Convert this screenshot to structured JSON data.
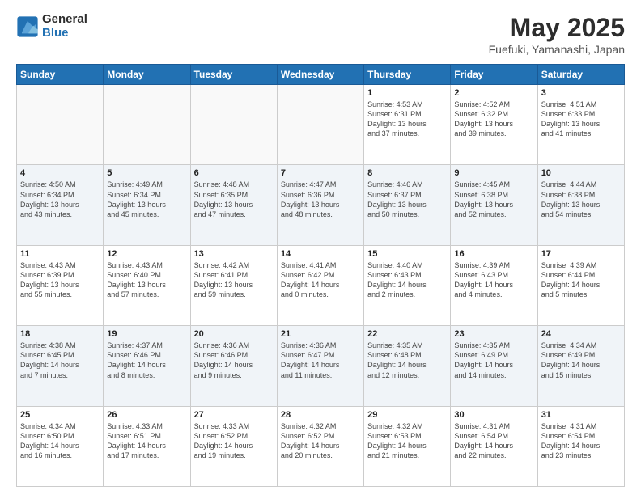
{
  "logo": {
    "line1": "General",
    "line2": "Blue"
  },
  "title": "May 2025",
  "subtitle": "Fuefuki, Yamanashi, Japan",
  "weekdays": [
    "Sunday",
    "Monday",
    "Tuesday",
    "Wednesday",
    "Thursday",
    "Friday",
    "Saturday"
  ],
  "weeks": [
    [
      {
        "day": "",
        "detail": ""
      },
      {
        "day": "",
        "detail": ""
      },
      {
        "day": "",
        "detail": ""
      },
      {
        "day": "",
        "detail": ""
      },
      {
        "day": "1",
        "detail": "Sunrise: 4:53 AM\nSunset: 6:31 PM\nDaylight: 13 hours\nand 37 minutes."
      },
      {
        "day": "2",
        "detail": "Sunrise: 4:52 AM\nSunset: 6:32 PM\nDaylight: 13 hours\nand 39 minutes."
      },
      {
        "day": "3",
        "detail": "Sunrise: 4:51 AM\nSunset: 6:33 PM\nDaylight: 13 hours\nand 41 minutes."
      }
    ],
    [
      {
        "day": "4",
        "detail": "Sunrise: 4:50 AM\nSunset: 6:34 PM\nDaylight: 13 hours\nand 43 minutes."
      },
      {
        "day": "5",
        "detail": "Sunrise: 4:49 AM\nSunset: 6:34 PM\nDaylight: 13 hours\nand 45 minutes."
      },
      {
        "day": "6",
        "detail": "Sunrise: 4:48 AM\nSunset: 6:35 PM\nDaylight: 13 hours\nand 47 minutes."
      },
      {
        "day": "7",
        "detail": "Sunrise: 4:47 AM\nSunset: 6:36 PM\nDaylight: 13 hours\nand 48 minutes."
      },
      {
        "day": "8",
        "detail": "Sunrise: 4:46 AM\nSunset: 6:37 PM\nDaylight: 13 hours\nand 50 minutes."
      },
      {
        "day": "9",
        "detail": "Sunrise: 4:45 AM\nSunset: 6:38 PM\nDaylight: 13 hours\nand 52 minutes."
      },
      {
        "day": "10",
        "detail": "Sunrise: 4:44 AM\nSunset: 6:38 PM\nDaylight: 13 hours\nand 54 minutes."
      }
    ],
    [
      {
        "day": "11",
        "detail": "Sunrise: 4:43 AM\nSunset: 6:39 PM\nDaylight: 13 hours\nand 55 minutes."
      },
      {
        "day": "12",
        "detail": "Sunrise: 4:43 AM\nSunset: 6:40 PM\nDaylight: 13 hours\nand 57 minutes."
      },
      {
        "day": "13",
        "detail": "Sunrise: 4:42 AM\nSunset: 6:41 PM\nDaylight: 13 hours\nand 59 minutes."
      },
      {
        "day": "14",
        "detail": "Sunrise: 4:41 AM\nSunset: 6:42 PM\nDaylight: 14 hours\nand 0 minutes."
      },
      {
        "day": "15",
        "detail": "Sunrise: 4:40 AM\nSunset: 6:43 PM\nDaylight: 14 hours\nand 2 minutes."
      },
      {
        "day": "16",
        "detail": "Sunrise: 4:39 AM\nSunset: 6:43 PM\nDaylight: 14 hours\nand 4 minutes."
      },
      {
        "day": "17",
        "detail": "Sunrise: 4:39 AM\nSunset: 6:44 PM\nDaylight: 14 hours\nand 5 minutes."
      }
    ],
    [
      {
        "day": "18",
        "detail": "Sunrise: 4:38 AM\nSunset: 6:45 PM\nDaylight: 14 hours\nand 7 minutes."
      },
      {
        "day": "19",
        "detail": "Sunrise: 4:37 AM\nSunset: 6:46 PM\nDaylight: 14 hours\nand 8 minutes."
      },
      {
        "day": "20",
        "detail": "Sunrise: 4:36 AM\nSunset: 6:46 PM\nDaylight: 14 hours\nand 9 minutes."
      },
      {
        "day": "21",
        "detail": "Sunrise: 4:36 AM\nSunset: 6:47 PM\nDaylight: 14 hours\nand 11 minutes."
      },
      {
        "day": "22",
        "detail": "Sunrise: 4:35 AM\nSunset: 6:48 PM\nDaylight: 14 hours\nand 12 minutes."
      },
      {
        "day": "23",
        "detail": "Sunrise: 4:35 AM\nSunset: 6:49 PM\nDaylight: 14 hours\nand 14 minutes."
      },
      {
        "day": "24",
        "detail": "Sunrise: 4:34 AM\nSunset: 6:49 PM\nDaylight: 14 hours\nand 15 minutes."
      }
    ],
    [
      {
        "day": "25",
        "detail": "Sunrise: 4:34 AM\nSunset: 6:50 PM\nDaylight: 14 hours\nand 16 minutes."
      },
      {
        "day": "26",
        "detail": "Sunrise: 4:33 AM\nSunset: 6:51 PM\nDaylight: 14 hours\nand 17 minutes."
      },
      {
        "day": "27",
        "detail": "Sunrise: 4:33 AM\nSunset: 6:52 PM\nDaylight: 14 hours\nand 19 minutes."
      },
      {
        "day": "28",
        "detail": "Sunrise: 4:32 AM\nSunset: 6:52 PM\nDaylight: 14 hours\nand 20 minutes."
      },
      {
        "day": "29",
        "detail": "Sunrise: 4:32 AM\nSunset: 6:53 PM\nDaylight: 14 hours\nand 21 minutes."
      },
      {
        "day": "30",
        "detail": "Sunrise: 4:31 AM\nSunset: 6:54 PM\nDaylight: 14 hours\nand 22 minutes."
      },
      {
        "day": "31",
        "detail": "Sunrise: 4:31 AM\nSunset: 6:54 PM\nDaylight: 14 hours\nand 23 minutes."
      }
    ]
  ]
}
